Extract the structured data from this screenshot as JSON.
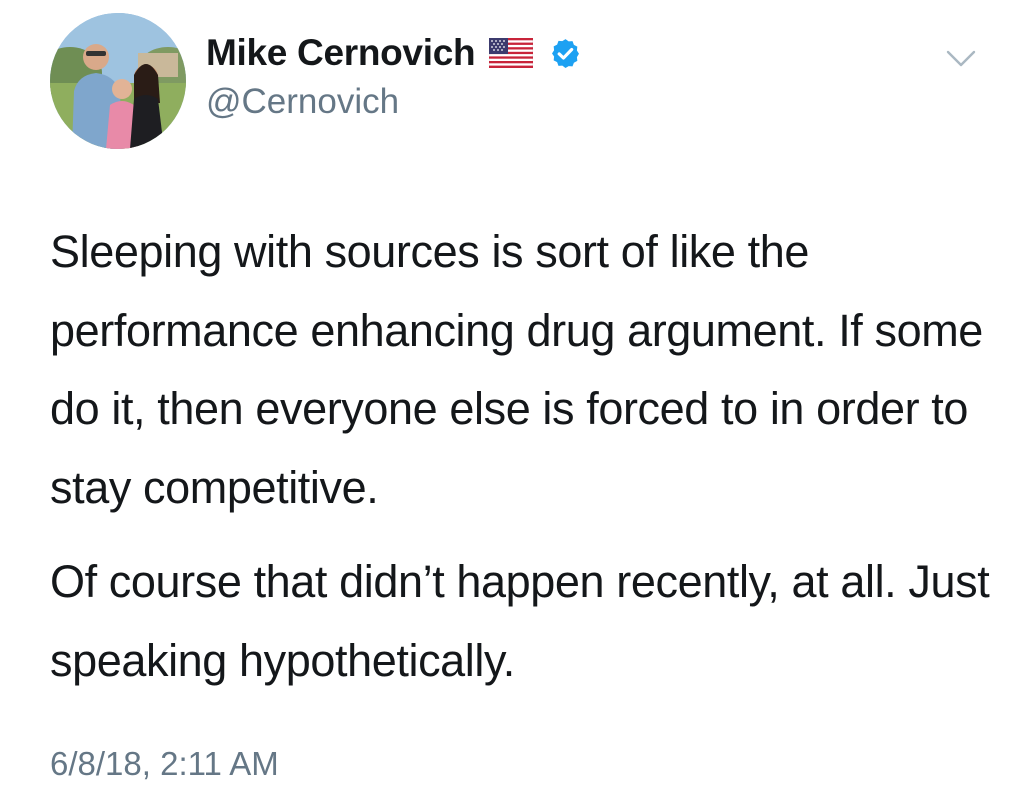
{
  "author": {
    "display_name": "Mike Cernovich",
    "handle": "@Cernovich",
    "flag_icon": "us-flag-icon",
    "verified_icon": "verified-badge-icon",
    "verified_color": "#1da1f2",
    "avatar_icon": "profile-avatar"
  },
  "menu": {
    "icon": "chevron-down-icon",
    "color": "#aab8c2"
  },
  "tweet": {
    "paragraph_1": "Sleeping with sources is sort of like the performance enhancing drug argument. If some do it, then everyone else is forced to in order to stay competitive.",
    "paragraph_2": "Of course that didn’t happen recently, at all. Just speaking hypothetically.",
    "timestamp": "6/8/18, 2:11 AM"
  },
  "colors": {
    "text_primary": "#14171a",
    "text_secondary": "#657786",
    "background": "#ffffff"
  }
}
